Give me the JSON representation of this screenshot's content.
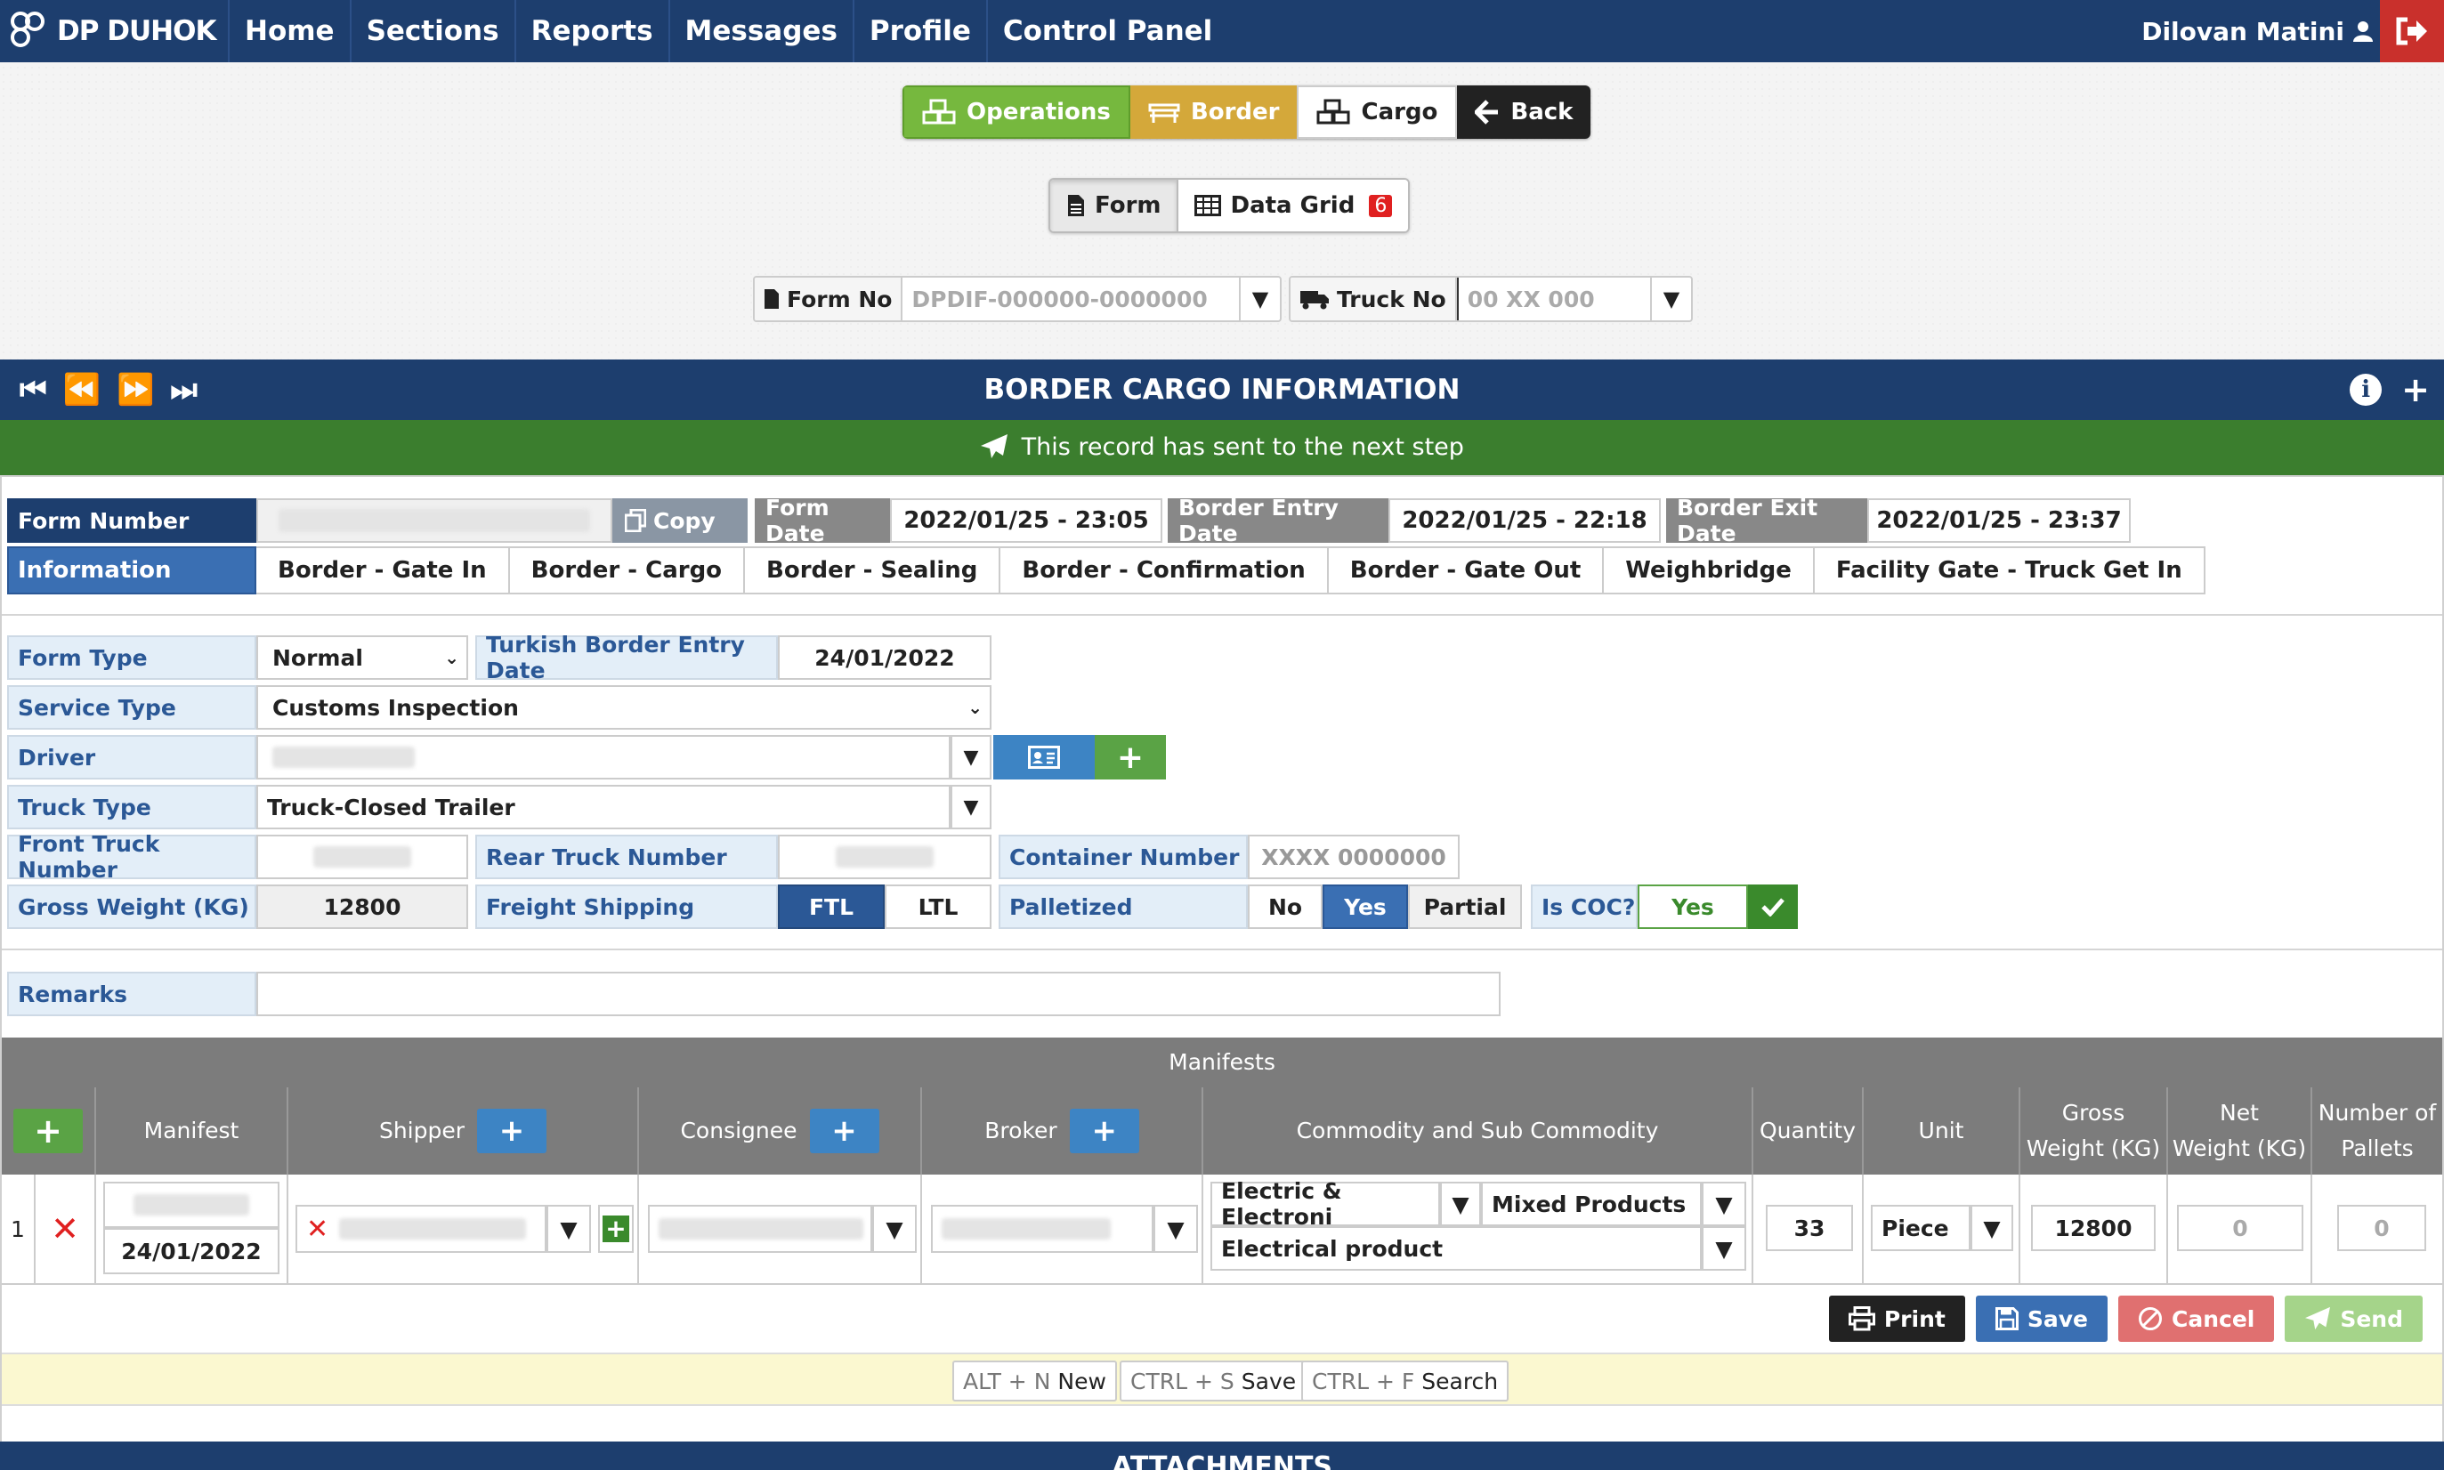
{
  "navbar": {
    "brand": "DP DUHOK",
    "items": [
      "Home",
      "Sections",
      "Reports",
      "Messages",
      "Profile",
      "Control Panel"
    ],
    "user": "Dilovan Matini"
  },
  "topgroup": {
    "operations": "Operations",
    "border": "Border",
    "cargo": "Cargo",
    "back": "Back"
  },
  "view": {
    "form": "Form",
    "grid": "Data Grid",
    "grid_count": "6"
  },
  "lookup": {
    "form_no_label": "Form No",
    "form_no_placeholder": "DPDIF-000000-0000000",
    "truck_no_label": "Truck No",
    "truck_no_placeholder": "00 XX 000"
  },
  "panel": {
    "title": "BORDER CARGO INFORMATION",
    "status": "This record has sent to the next step"
  },
  "record": {
    "form_number_label": "Form Number",
    "copy": "Copy",
    "form_date_label": "Form Date",
    "form_date": "2022/01/25 - 23:05",
    "border_entry_label": "Border Entry Date",
    "border_entry": "2022/01/25 - 22:18",
    "border_exit_label": "Border Exit Date",
    "border_exit": "2022/01/25 - 23:37"
  },
  "tabs": [
    "Information",
    "Border - Gate In",
    "Border - Cargo",
    "Border - Sealing",
    "Border - Confirmation",
    "Border - Gate Out",
    "Weighbridge",
    "Facility Gate - Truck Get In"
  ],
  "form": {
    "form_type_label": "Form Type",
    "form_type": "Normal",
    "turkish_entry_label": "Turkish Border Entry Date",
    "turkish_entry": "24/01/2022",
    "service_type_label": "Service Type",
    "service_type": "Customs Inspection",
    "driver_label": "Driver",
    "truck_type_label": "Truck Type",
    "truck_type": "Truck-Closed Trailer",
    "front_truck_label": "Front Truck Number",
    "rear_truck_label": "Rear Truck Number",
    "container_label": "Container Number",
    "container_placeholder": "XXXX 0000000",
    "gross_weight_label": "Gross Weight (KG)",
    "gross_weight": "12800",
    "freight_label": "Freight Shipping",
    "freight_ftl": "FTL",
    "freight_ltl": "LTL",
    "palletized_label": "Palletized",
    "pal_no": "No",
    "pal_yes": "Yes",
    "pal_partial": "Partial",
    "coc_label": "Is COC?",
    "coc_value": "Yes",
    "remarks_label": "Remarks"
  },
  "manifests": {
    "title": "Manifests",
    "columns": {
      "manifest": "Manifest",
      "shipper": "Shipper",
      "consignee": "Consignee",
      "broker": "Broker",
      "commodity": "Commodity and Sub Commodity",
      "quantity": "Quantity",
      "unit": "Unit",
      "gross_1": "Gross",
      "gross_2": "Weight (KG)",
      "net_1": "Net",
      "net_2": "Weight (KG)",
      "pallets_1": "Number of",
      "pallets_2": "Pallets"
    },
    "row": {
      "index": "1",
      "date": "24/01/2022",
      "commodity": "Electric & Electroni",
      "sub_commodity": "Mixed Products",
      "product": "Electrical product",
      "quantity": "33",
      "unit": "Piece",
      "gross": "12800",
      "net": "0",
      "pallets": "0"
    }
  },
  "actions": {
    "print": "Print",
    "save": "Save",
    "cancel": "Cancel",
    "send": "Send"
  },
  "shortcuts": [
    {
      "keys": "ALT + N",
      "label": "New"
    },
    {
      "keys": "CTRL + S",
      "label": "Save"
    },
    {
      "keys": "CTRL + F",
      "label": "Search"
    }
  ],
  "attachments_title": "ATTACHMENTS"
}
